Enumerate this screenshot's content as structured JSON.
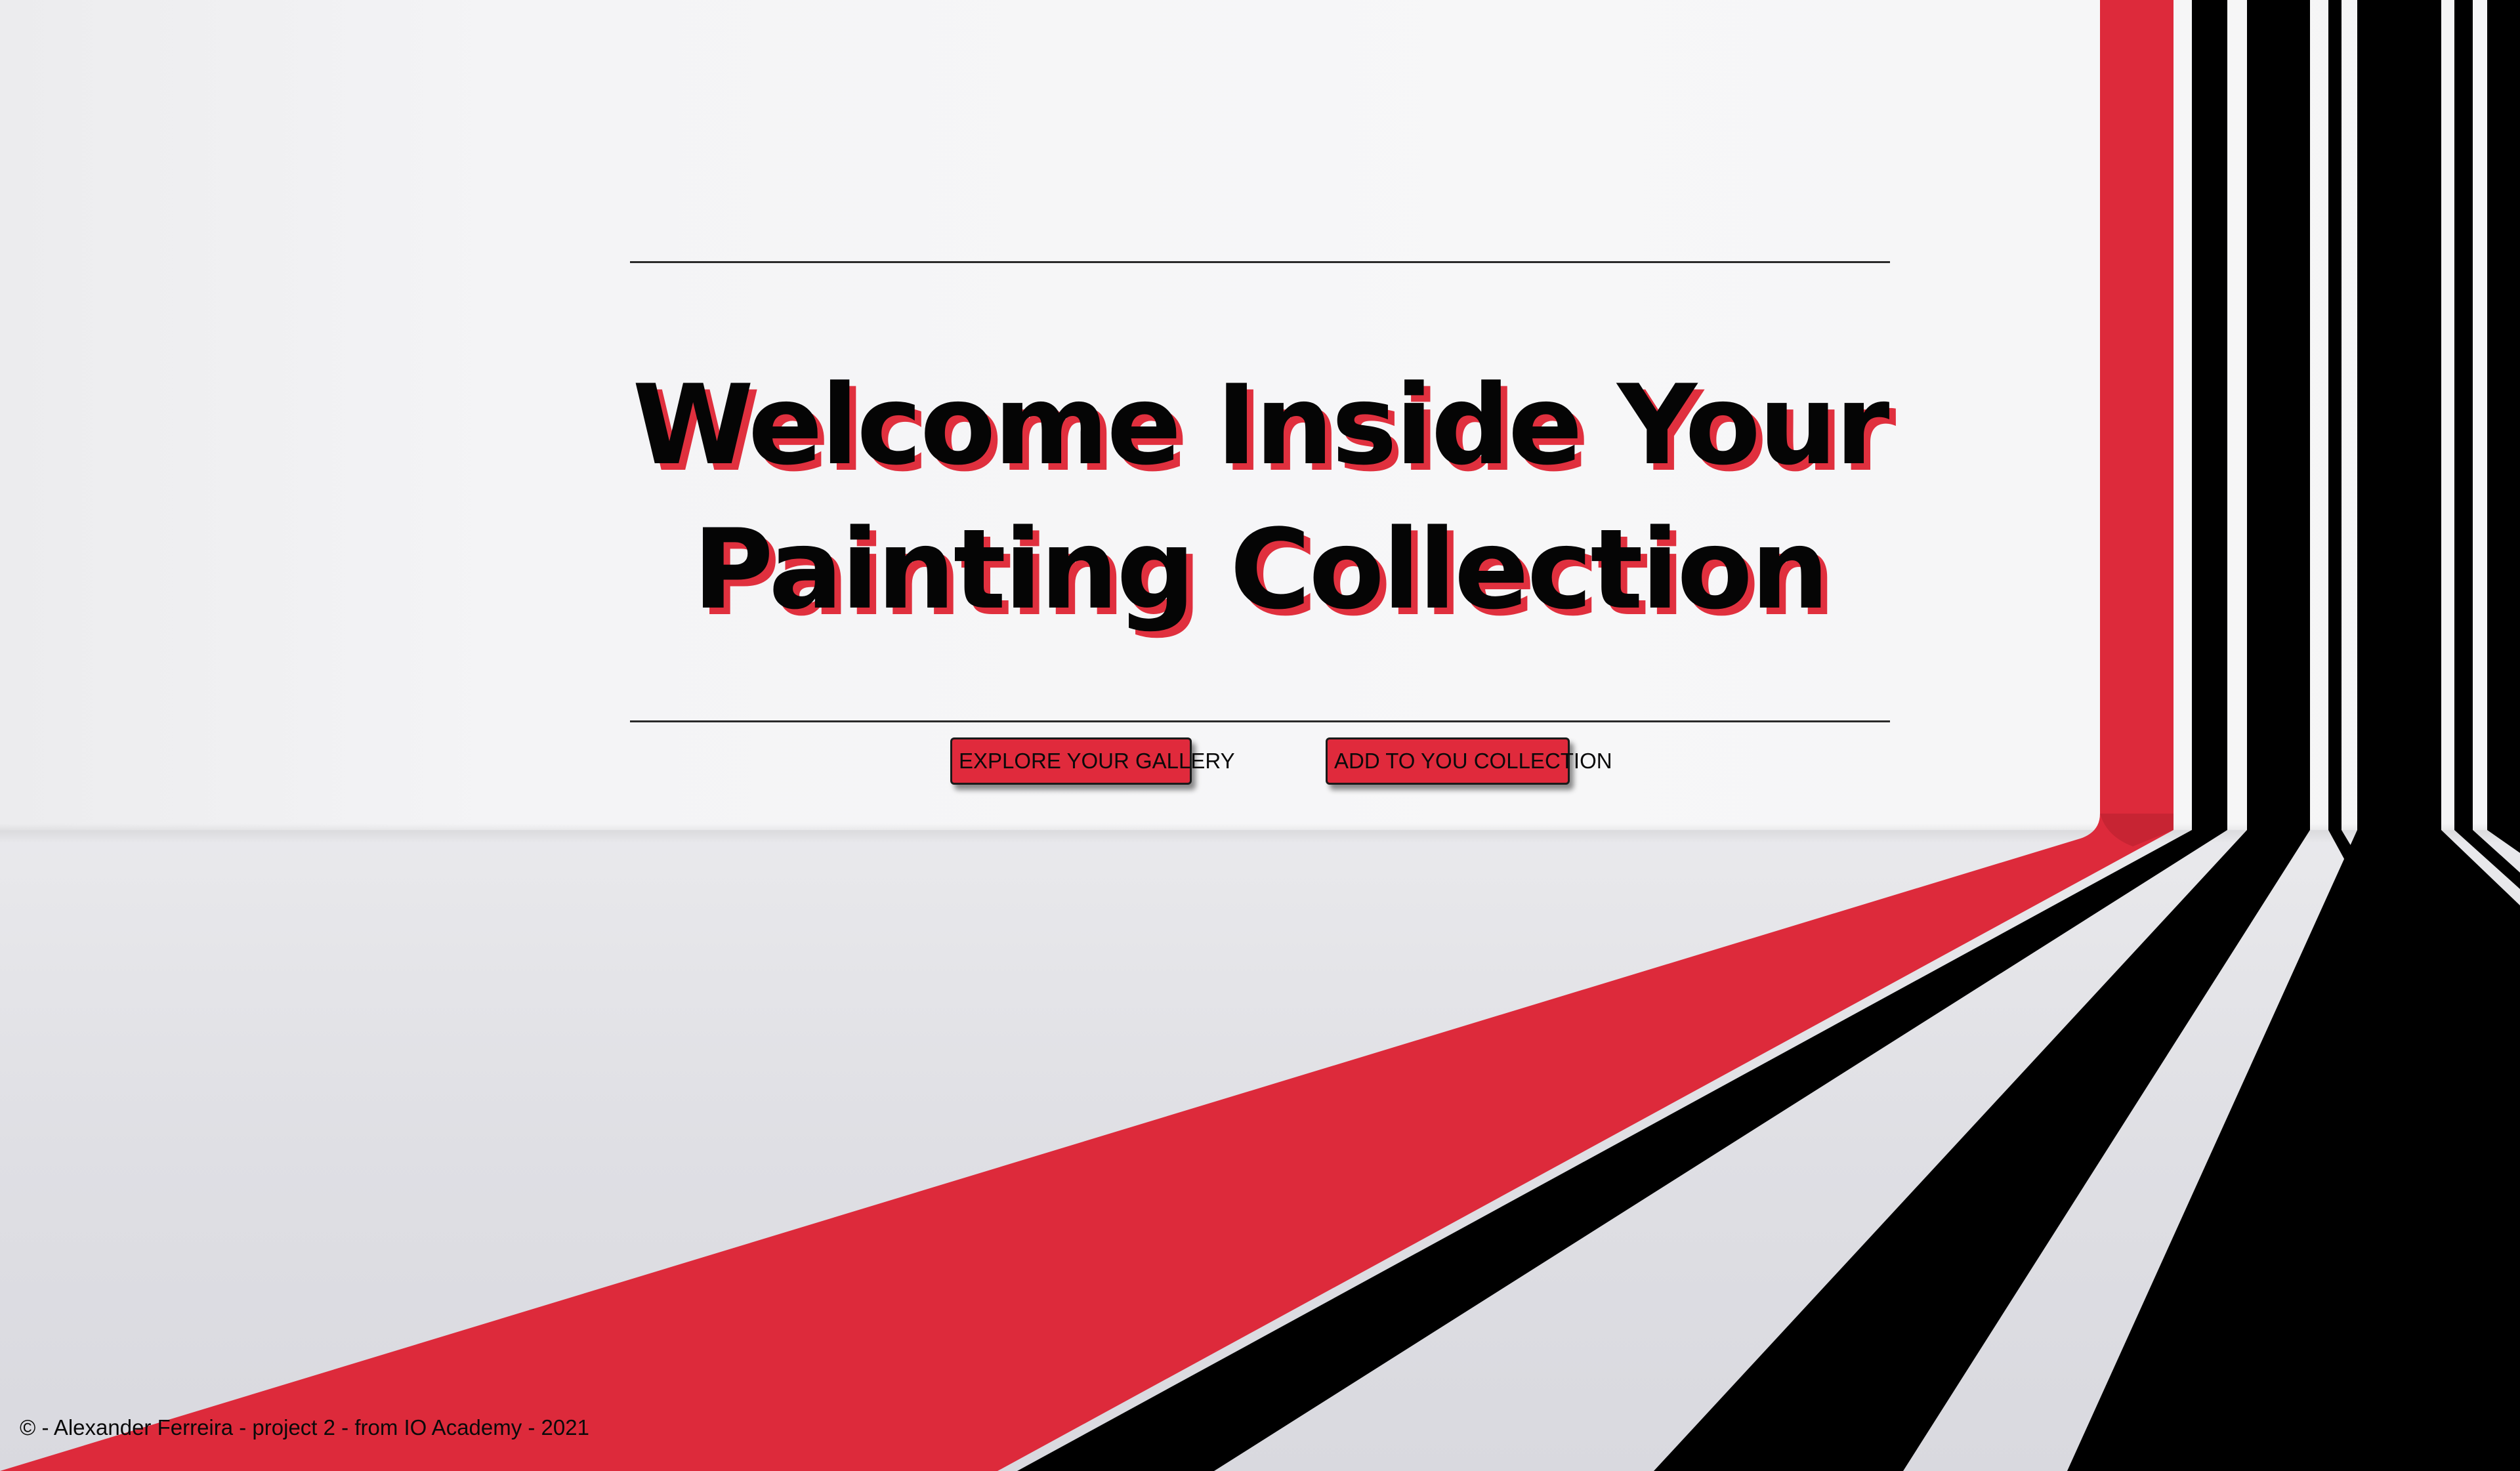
{
  "hero": {
    "title_line1": "Welcome Inside Your",
    "title_line2": "Painting Collection"
  },
  "actions": {
    "explore_label": "EXPLORE YOUR GALLERY",
    "add_label": "ADD TO YOU COLLECTION"
  },
  "footer": {
    "text": "© - Alexander Ferreira - project 2 - from IO Academy - 2021"
  },
  "colors": {
    "accent_red": "#e02a3c",
    "stripe_black": "#000000",
    "wall": "#f5f5f6",
    "floor": "#dcdce1"
  }
}
